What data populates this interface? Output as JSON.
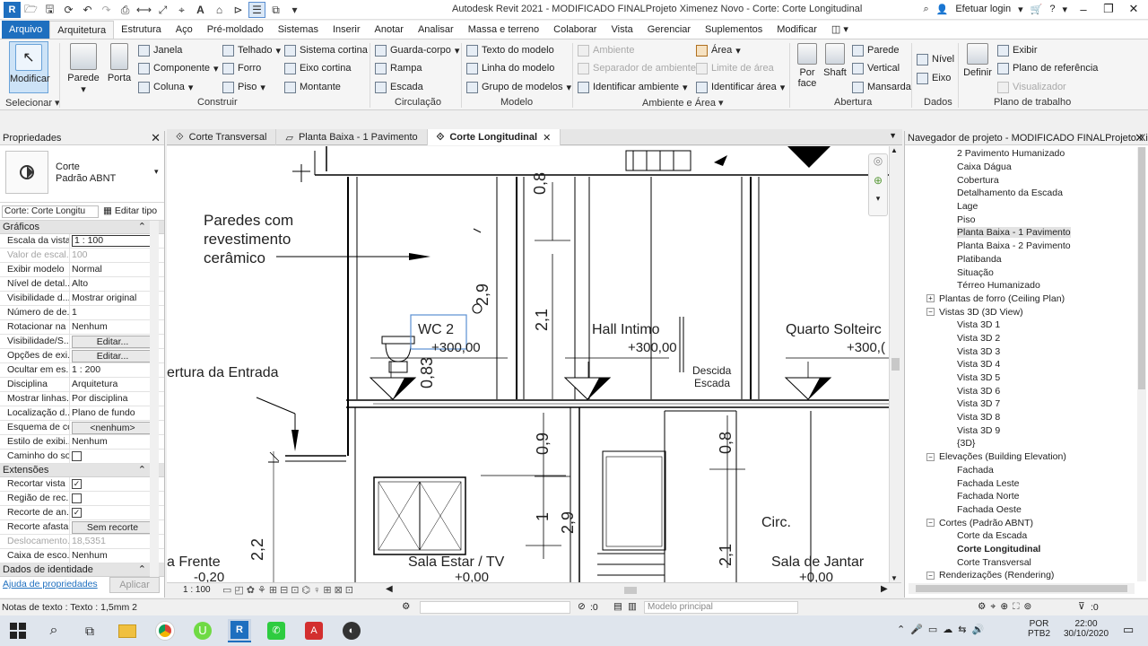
{
  "titlebar": {
    "title": "Autodesk Revit 2021 - MODIFICADO FINALProjeto Ximenez Novo - Corte: Corte Longitudinal",
    "login": "Efetuar login"
  },
  "ribbon": {
    "tabs": [
      "Arquivo",
      "Arquitetura",
      "Estrutura",
      "Aço",
      "Pré-moldado",
      "Sistemas",
      "Inserir",
      "Anotar",
      "Analisar",
      "Massa e terreno",
      "Colaborar",
      "Vista",
      "Gerenciar",
      "Suplementos",
      "Modificar"
    ],
    "selecionar": {
      "modificar": "Modificar",
      "label": "Selecionar"
    },
    "construir": {
      "parede": "Parede",
      "porta": "Porta",
      "janela": "Janela",
      "componente": "Componente",
      "coluna": "Coluna",
      "telhado": "Telhado",
      "forro": "Forro",
      "piso": "Piso",
      "sistema_cortina": "Sistema cortina",
      "eixo_cortina": "Eixo cortina",
      "montante": "Montante",
      "label": "Construir"
    },
    "circulacao": {
      "guarda_corpo": "Guarda-corpo",
      "rampa": "Rampa",
      "escada": "Escada",
      "label": "Circulação"
    },
    "modelo": {
      "texto": "Texto do modelo",
      "linha": "Linha do modelo",
      "grupo": "Grupo de modelos",
      "label": "Modelo"
    },
    "ambiente": {
      "ambiente": "Ambiente",
      "separador": "Separador de ambiente",
      "identificar_ambiente": "Identificar ambiente",
      "area": "Área",
      "limite_area": "Limite de área",
      "identificar_area": "Identificar área",
      "label": "Ambiente e Área"
    },
    "abertura": {
      "por_face": "Por face",
      "shaft": "Shaft",
      "parede": "Parede",
      "vertical": "Vertical",
      "mansarda": "Mansarda",
      "label": "Abertura"
    },
    "dados": {
      "nivel": "Nível",
      "eixo": "Eixo",
      "label": "Dados"
    },
    "plano": {
      "definir": "Definir",
      "exibir": "Exibir",
      "plano_ref": "Plano de referência",
      "visualizador": "Visualizador",
      "label": "Plano de trabalho"
    }
  },
  "properties": {
    "title": "Propriedades",
    "type_name": "Corte",
    "type_sub": "Padrão ABNT",
    "selector": "Corte: Corte Longitu",
    "edit_type": "Editar tipo",
    "groups": {
      "graficos": "Gráficos",
      "extensoes": "Extensões",
      "identidade": "Dados de identidade"
    },
    "rows": [
      {
        "k": "Escala da vista",
        "v": "1 : 100"
      },
      {
        "k": "Valor de escal...",
        "v": "100"
      },
      {
        "k": "Exibir modelo",
        "v": "Normal"
      },
      {
        "k": "Nível de detal...",
        "v": "Alto"
      },
      {
        "k": "Visibilidade d...",
        "v": "Mostrar original"
      },
      {
        "k": "Número de de...",
        "v": "1"
      },
      {
        "k": "Rotacionar na ...",
        "v": "Nenhum"
      },
      {
        "k": "Visibilidade/S...",
        "v": "Editar..."
      },
      {
        "k": "Opções de exi...",
        "v": "Editar..."
      },
      {
        "k": "Ocultar em es...",
        "v": "1 : 200"
      },
      {
        "k": "Disciplina",
        "v": "Arquitetura"
      },
      {
        "k": "Mostrar linhas...",
        "v": "Por disciplina"
      },
      {
        "k": "Localização d...",
        "v": "Plano de fundo"
      },
      {
        "k": "Esquema de cor",
        "v": "<nenhum>"
      },
      {
        "k": "Estilo de exibi...",
        "v": "Nenhum"
      },
      {
        "k": "Caminho do sol",
        "v": ""
      }
    ],
    "ext_rows": [
      {
        "k": "Recortar vista",
        "v": "✓"
      },
      {
        "k": "Região de rec...",
        "v": ""
      },
      {
        "k": "Recorte de an...",
        "v": "✓"
      },
      {
        "k": "Recorte afasta...",
        "v": "Sem recorte"
      },
      {
        "k": "Deslocamento...",
        "v": "18,5351"
      },
      {
        "k": "Caixa de esco...",
        "v": "Nenhum"
      }
    ],
    "help_link": "Ajuda de propriedades",
    "apply": "Aplicar"
  },
  "viewtabs": [
    "Corte Transversal",
    "Planta Baixa - 1 Pavimento",
    "Corte Longitudinal"
  ],
  "drawing": {
    "note_lines": [
      "Paredes com",
      "revestimento",
      "cerâmico"
    ],
    "cobertura_entrada": "ertura da Entrada",
    "wc2": "WC 2",
    "wc2_level": "+300,00",
    "hall": "Hall Intimo",
    "hall_level": "+300,00",
    "quarto": "Quarto Solteirc",
    "quarto_level": "+300,(",
    "descida": "Descida",
    "escada": "Escada",
    "circ": "Circ.",
    "sala_estar": "Sala Estar / TV",
    "sala_estar_level": "+0,00",
    "sala_jantar": "Sala de Jantar",
    "sala_jantar_level": "+0,00",
    "frente": "a Frente",
    "frente_level": "-0,20",
    "dims": {
      "d08a": "0,8",
      "d29a": "2,9",
      "d21a": "2,1",
      "d083": "0,83",
      "d09": "0,9",
      "d1": "1",
      "d29b": "2,9",
      "d22": "2,2",
      "d08b": "0,8",
      "d21b": "2,1"
    }
  },
  "viewbar": {
    "scale": "1 : 100"
  },
  "browser": {
    "title": "Navegador de projeto - MODIFICADO FINALProjeto Xi...",
    "nodes": [
      {
        "label": "2 Pavimento Humanizado",
        "level": 2
      },
      {
        "label": "Caixa Dágua",
        "level": 2
      },
      {
        "label": "Cobertura",
        "level": 2
      },
      {
        "label": "Detalhamento da Escada",
        "level": 2
      },
      {
        "label": "Lage",
        "level": 2
      },
      {
        "label": "Piso",
        "level": 2
      },
      {
        "label": "Planta Baixa - 1 Pavimento",
        "level": 2,
        "sel": true
      },
      {
        "label": "Planta Baixa - 2 Pavimento",
        "level": 2
      },
      {
        "label": "Platibanda",
        "level": 2
      },
      {
        "label": "Situação",
        "level": 2
      },
      {
        "label": "Térreo Humanizado",
        "level": 2
      },
      {
        "label": "Plantas de forro (Ceiling Plan)",
        "level": 1,
        "tog": "+"
      },
      {
        "label": "Vistas 3D (3D View)",
        "level": 1,
        "tog": "−"
      },
      {
        "label": "Vista 3D 1",
        "level": 2
      },
      {
        "label": "Vista 3D 2",
        "level": 2
      },
      {
        "label": "Vista 3D 3",
        "level": 2
      },
      {
        "label": "Vista 3D 4",
        "level": 2
      },
      {
        "label": "Vista 3D 5",
        "level": 2
      },
      {
        "label": "Vista 3D 6",
        "level": 2
      },
      {
        "label": "Vista 3D 7",
        "level": 2
      },
      {
        "label": "Vista 3D 8",
        "level": 2
      },
      {
        "label": "Vista 3D 9",
        "level": 2
      },
      {
        "label": "{3D}",
        "level": 2
      },
      {
        "label": "Elevações (Building Elevation)",
        "level": 1,
        "tog": "−"
      },
      {
        "label": "Fachada",
        "level": 2
      },
      {
        "label": "Fachada Leste",
        "level": 2
      },
      {
        "label": "Fachada Norte",
        "level": 2
      },
      {
        "label": "Fachada Oeste",
        "level": 2
      },
      {
        "label": "Cortes (Padrão ABNT)",
        "level": 1,
        "tog": "−"
      },
      {
        "label": "Corte da Escada",
        "level": 2
      },
      {
        "label": "Corte Longitudinal",
        "level": 2,
        "bold": true
      },
      {
        "label": "Corte Transversal",
        "level": 2
      },
      {
        "label": "Renderizações (Rendering)",
        "level": 1,
        "tog": "−"
      }
    ]
  },
  "statusbar": {
    "left": "Notas de texto : Texto : 1,5mm 2",
    "zero": ":0",
    "model": "Modelo principal",
    "filter": ":0"
  },
  "taskbar": {
    "lang1": "POR",
    "lang2": "PTB2",
    "time": "22:00",
    "date": "30/10/2020"
  },
  "colors": {
    "accent": "#1e6fbf",
    "selection": "#5b8fd1"
  }
}
